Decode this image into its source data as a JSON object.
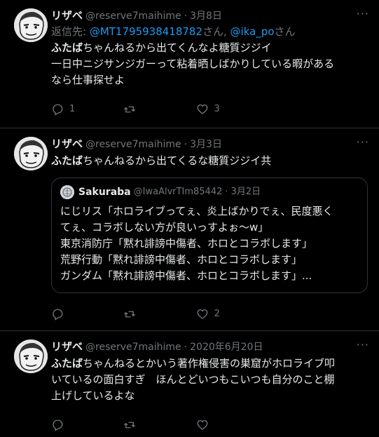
{
  "tweets": [
    {
      "name": "リザベ",
      "handle": "@reserve7maihime",
      "dot": "·",
      "time": "3月8日",
      "more": "···",
      "reply_prefix": "返信先: ",
      "reply_user1": "@MT1795938418782",
      "reply_mid": "さん, ",
      "reply_user2": "@ika_po",
      "reply_suffix": "さん",
      "bold": "ふたば",
      "text": "ちゃんねるから出てくんなよ糖質ジジイ\n一日中ニジサンジガーって粘着晒しばかりしている暇がある\nなら仕事探せよ",
      "replies": "1",
      "retweets": "",
      "likes": "3"
    },
    {
      "name": "リザベ",
      "handle": "@reserve7maihime",
      "dot": "·",
      "time": "3月3日",
      "more": "···",
      "bold": "ふたば",
      "text": "ちゃんねるから出てくるな糖質ジジイ共",
      "quote": {
        "name": "Sakuraba",
        "handle": "@IwaAlvrTIm85442",
        "dot": "·",
        "time": "3月2日",
        "text": "にじリス「ホロライブってぇ、炎上ばかりでぇ、民度悪く\nてぇ、コラボしない方が良いっすよぉ〜w」\n東京消防庁「黙れ誹謗中傷者、ホロとコラボします」\n荒野行動「黙れ誹謗中傷者、ホロとコラボします」\nガンダム「黙れ誹謗中傷者、ホロとコラボします」..."
      },
      "replies": "",
      "retweets": "",
      "likes": "2"
    },
    {
      "name": "リザベ",
      "handle": "@reserve7maihime",
      "dot": "·",
      "time": "2020年6月20日",
      "more": "···",
      "bold": "ふたば",
      "text": "ちゃんねるとかいう著作権侵害の巣窟がホロライブ叩\nいているの面白すぎ　ほんとどいつもこいつも自分のこと棚\n上げしているよな",
      "replies": "",
      "retweets": "",
      "likes": ""
    }
  ],
  "colors": {
    "background": "#000000",
    "text": "#e7e9ea",
    "muted": "#71767b",
    "link": "#1d9bf0",
    "border": "#2f3336"
  }
}
